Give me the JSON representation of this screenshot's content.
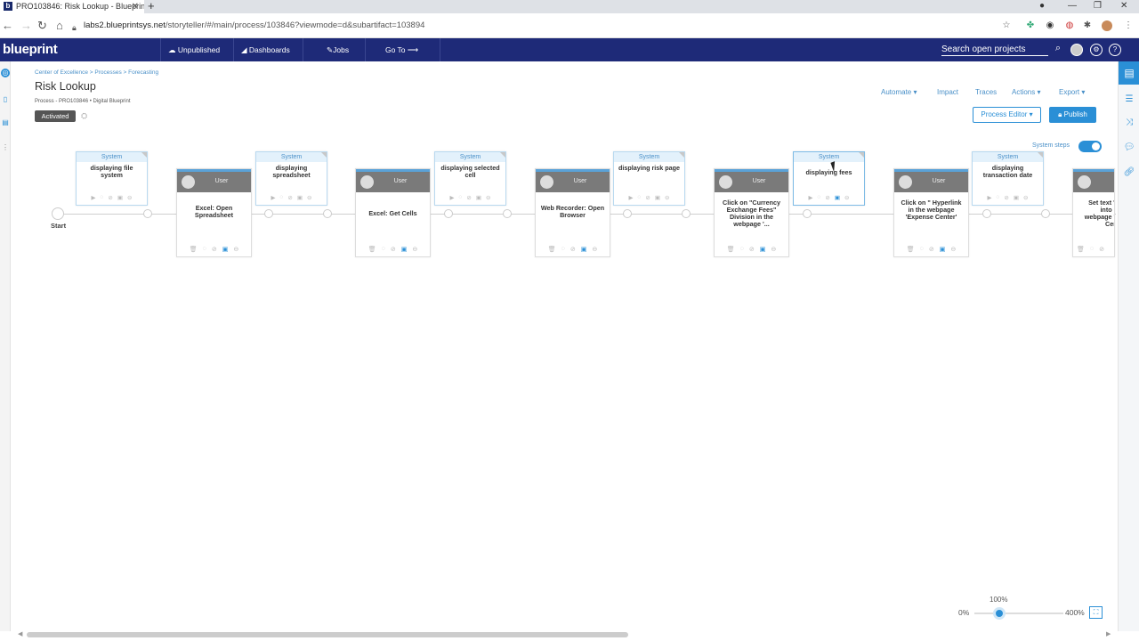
{
  "browser": {
    "tab_title": "PRO103846: Risk Lookup - Blueprint",
    "new_tab": "+",
    "url_host": "labs2.blueprintsys.net",
    "url_path": "/storyteller/#/main/process/103846?viewmode=d&subartifact=103894"
  },
  "app": {
    "logo": "blueprint",
    "nav": [
      "Unpublished",
      "Dashboards",
      "Jobs",
      "Go To ⟶"
    ],
    "search_placeholder": "Search open projects"
  },
  "page": {
    "breadcrumb": "Center of Excellence  >  Processes  >  Forecasting",
    "title": "Risk Lookup",
    "subtitle": "Process - PRO103846 • Digital Blueprint",
    "status": "Activated",
    "toolbar": {
      "automate": "Automate ▾",
      "impact": "Impact",
      "traces": "Traces",
      "actions": "Actions ▾",
      "export": "Export ▾"
    },
    "process_editor": "Process Editor ▾",
    "publish": "Publish",
    "system_steps_label": "System steps"
  },
  "process": {
    "start_label": "Start",
    "system_steps": [
      {
        "role": "System",
        "text": "displaying file system"
      },
      {
        "role": "System",
        "text": "displaying spreadsheet"
      },
      {
        "role": "System",
        "text": "displaying selected cell"
      },
      {
        "role": "System",
        "text": "displaying risk page"
      },
      {
        "role": "System",
        "text": "displaying fees"
      },
      {
        "role": "System",
        "text": "displaying transaction date"
      }
    ],
    "user_steps": [
      {
        "role": "User",
        "text": "Excel: Open Spreadsheet"
      },
      {
        "role": "User",
        "text": "Excel: Get Cells"
      },
      {
        "role": "User",
        "text": "Web Recorder: Open Browser"
      },
      {
        "role": "User",
        "text": "Click on \"Currency Exchange Fees\" Division in the webpage '..."
      },
      {
        "role": "User",
        "text": "Click on \" Hyperlink in the webpage 'Expense Center'"
      },
      {
        "role": "User",
        "text": "Set text 'C into in webpage 'E Cent"
      }
    ]
  },
  "zoom": {
    "value": "100%",
    "min": "0%",
    "max": "400%"
  },
  "colors": {
    "header": "#1e2a78",
    "accent": "#2a8fd6"
  }
}
